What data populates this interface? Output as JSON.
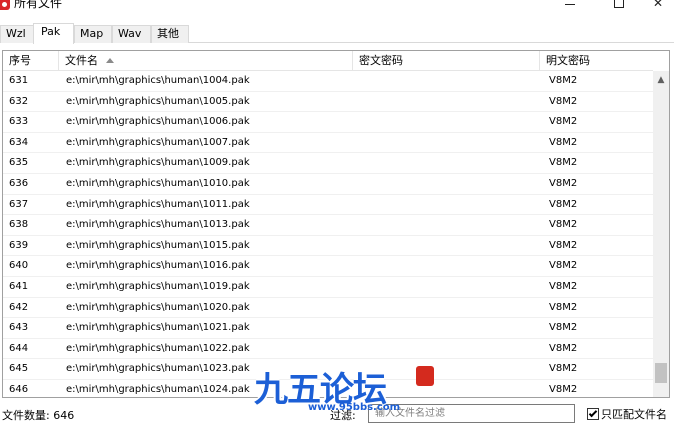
{
  "window": {
    "title": "所有文件",
    "icon": "app-icon"
  },
  "tabs": [
    {
      "label": "Wzl",
      "active": false
    },
    {
      "label": "Pak",
      "active": true
    },
    {
      "label": "Map",
      "active": false
    },
    {
      "label": "Wav",
      "active": false
    },
    {
      "label": "其他",
      "active": false
    }
  ],
  "table": {
    "columns": {
      "seq": "序号",
      "file": "文件名",
      "cipher": "密文密码",
      "plain": "明文密码"
    },
    "sort_column": "file",
    "sort_direction": "ascending",
    "rows": [
      {
        "seq": "631",
        "file": "e:\\mir\\mh\\graphics\\human\\1004.pak",
        "cipher": "",
        "plain": "V8M2"
      },
      {
        "seq": "632",
        "file": "e:\\mir\\mh\\graphics\\human\\1005.pak",
        "cipher": "",
        "plain": "V8M2"
      },
      {
        "seq": "633",
        "file": "e:\\mir\\mh\\graphics\\human\\1006.pak",
        "cipher": "",
        "plain": "V8M2"
      },
      {
        "seq": "634",
        "file": "e:\\mir\\mh\\graphics\\human\\1007.pak",
        "cipher": "",
        "plain": "V8M2"
      },
      {
        "seq": "635",
        "file": "e:\\mir\\mh\\graphics\\human\\1009.pak",
        "cipher": "",
        "plain": "V8M2"
      },
      {
        "seq": "636",
        "file": "e:\\mir\\mh\\graphics\\human\\1010.pak",
        "cipher": "",
        "plain": "V8M2"
      },
      {
        "seq": "637",
        "file": "e:\\mir\\mh\\graphics\\human\\1011.pak",
        "cipher": "",
        "plain": "V8M2"
      },
      {
        "seq": "638",
        "file": "e:\\mir\\mh\\graphics\\human\\1013.pak",
        "cipher": "",
        "plain": "V8M2"
      },
      {
        "seq": "639",
        "file": "e:\\mir\\mh\\graphics\\human\\1015.pak",
        "cipher": "",
        "plain": "V8M2"
      },
      {
        "seq": "640",
        "file": "e:\\mir\\mh\\graphics\\human\\1016.pak",
        "cipher": "",
        "plain": "V8M2"
      },
      {
        "seq": "641",
        "file": "e:\\mir\\mh\\graphics\\human\\1019.pak",
        "cipher": "",
        "plain": "V8M2"
      },
      {
        "seq": "642",
        "file": "e:\\mir\\mh\\graphics\\human\\1020.pak",
        "cipher": "",
        "plain": "V8M2"
      },
      {
        "seq": "643",
        "file": "e:\\mir\\mh\\graphics\\human\\1021.pak",
        "cipher": "",
        "plain": "V8M2"
      },
      {
        "seq": "644",
        "file": "e:\\mir\\mh\\graphics\\human\\1022.pak",
        "cipher": "",
        "plain": "V8M2"
      },
      {
        "seq": "645",
        "file": "e:\\mir\\mh\\graphics\\human\\1023.pak",
        "cipher": "",
        "plain": "V8M2"
      },
      {
        "seq": "646",
        "file": "e:\\mir\\mh\\graphics\\human\\1024.pak",
        "cipher": "",
        "plain": "V8M2"
      }
    ]
  },
  "status": {
    "count_label": "文件数量: 646",
    "filter_label": "过滤:",
    "filter_value": "",
    "filter_placeholder": "输入文件名过滤",
    "match_only_label": "只匹配文件名",
    "match_only_checked": true
  },
  "watermark": {
    "text": "九五论坛",
    "sub": "www.95bbs.com"
  },
  "colors": {
    "watermark": "#1c5fd6",
    "app_icon": "#d9262a"
  }
}
